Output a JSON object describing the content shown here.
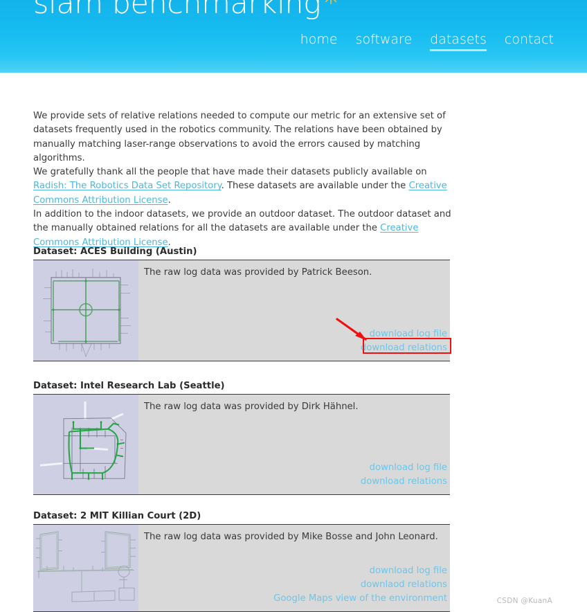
{
  "header": {
    "logo_text": "slam benchmarking",
    "logo_star": "✳",
    "nav": [
      {
        "label": "home",
        "active": false
      },
      {
        "label": "software",
        "active": false
      },
      {
        "label": "datasets",
        "active": true
      },
      {
        "label": "contact",
        "active": false
      }
    ],
    "colors": {
      "bg_top": "#13b3ec",
      "bg_bottom": "#4fd2f7",
      "star": "#f5c03a",
      "underline": "#bfe9f8"
    }
  },
  "intro": {
    "p1_a": "We provide sets of relative relations needed to compute our metric for an extensive set of datasets frequently used in the robotics community. The relations have been obtained by manually matching laser-range observations to avoid the errors caused by matching algorithms.",
    "p2_a": "We gratefully thank all the people that have made their datasets publicly available on ",
    "p2_link1": "Radish: The Robotics Data Set Repository",
    "p2_b": ". These datasets are available under the ",
    "p2_link2": "Creative Commons Attribution License",
    "p2_c": ".",
    "p3_a": "In addition to the indoor datasets, we provide an outdoor dataset. The outdoor dataset and the manually obtained relations for all the datasets are available under the ",
    "p3_link1": "Creative Commons Attribution License",
    "p3_b": "."
  },
  "datasets": [
    {
      "title": "Dataset: ACES Building (Austin)",
      "description": "The raw log data was provided by Patrick Beeson.",
      "links": [
        {
          "label": "download log file",
          "highlighted": true
        },
        {
          "label": "download relations",
          "highlighted": false
        }
      ],
      "thumbnail_name": "aces-building-map"
    },
    {
      "title": "Dataset: Intel Research Lab (Seattle)",
      "description": "The raw log data was provided by Dirk Hähnel.",
      "links": [
        {
          "label": "download log file",
          "highlighted": false
        },
        {
          "label": "download relations",
          "highlighted": false
        }
      ],
      "thumbnail_name": "intel-research-lab-map"
    },
    {
      "title": "Dataset: 2 MIT Killian Court (2D)",
      "description": "The raw log data was provided by Mike Bosse and John Leonard.",
      "links": [
        {
          "label": "download log file",
          "highlighted": false
        },
        {
          "label": "downlaod relations",
          "highlighted": false
        },
        {
          "label": "Google Maps view of the environment",
          "highlighted": false
        }
      ],
      "thumbnail_name": "mit-killian-court-map"
    }
  ],
  "annotation": {
    "color": "#ee1111",
    "target_link": "download log file",
    "shape": "arrow-and-box"
  },
  "watermark": {
    "text": "CSDN @KuanA"
  },
  "colors": {
    "panel_bg": "#d9d9d9",
    "thumb_bg": "#cfcfe4",
    "link": "#6ac7ea",
    "body_text": "#3a3a3a",
    "rule": "#3a3a3a"
  }
}
